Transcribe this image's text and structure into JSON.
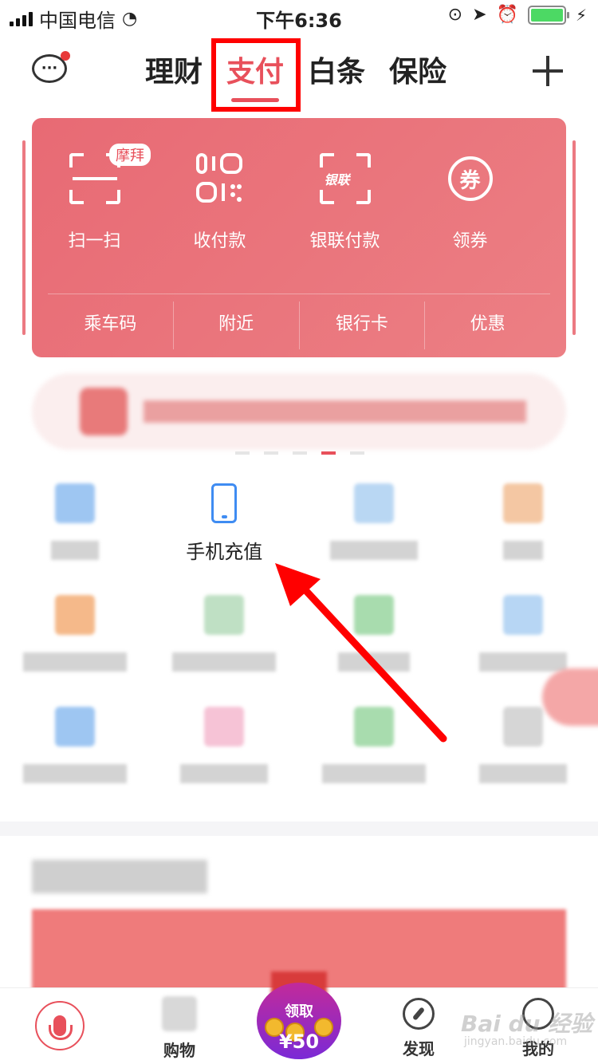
{
  "status_bar": {
    "carrier": "中国电信",
    "time": "下午6:36"
  },
  "header": {
    "tabs": [
      {
        "label": "理财"
      },
      {
        "label": "支付"
      },
      {
        "label": "白条"
      },
      {
        "label": "保险"
      }
    ],
    "active_tab": "支付",
    "message_dot_color": "#e83a3a"
  },
  "pay_card": {
    "actions": [
      {
        "label": "扫一扫",
        "icon": "scan-icon",
        "tag": "摩拜"
      },
      {
        "label": "收付款",
        "icon": "payment-code-icon"
      },
      {
        "label": "银联付款",
        "icon": "unionpay-icon",
        "icon_text": "银联"
      },
      {
        "label": "领券",
        "icon": "coupon-icon",
        "icon_text": "券"
      }
    ],
    "sub_items": [
      {
        "label": "乘车码"
      },
      {
        "label": "附近"
      },
      {
        "label": "银行卡"
      },
      {
        "label": "优惠"
      }
    ],
    "color": "#e86a74"
  },
  "services": {
    "highlight_label": "手机充值"
  },
  "tabbar": {
    "items": [
      {
        "label": "购物"
      },
      {
        "label": "发现"
      },
      {
        "label": "我的"
      }
    ],
    "red_packet": {
      "get_label": "领取",
      "amount": "¥50"
    }
  },
  "watermark": {
    "text": "Bai du 经验",
    "url": "jingyan.baidu.com"
  },
  "colors": {
    "accent": "#e8505b",
    "highlight_box": "#ff0000",
    "arrow": "#ff0000",
    "phone_icon": "#3f8cf2"
  }
}
